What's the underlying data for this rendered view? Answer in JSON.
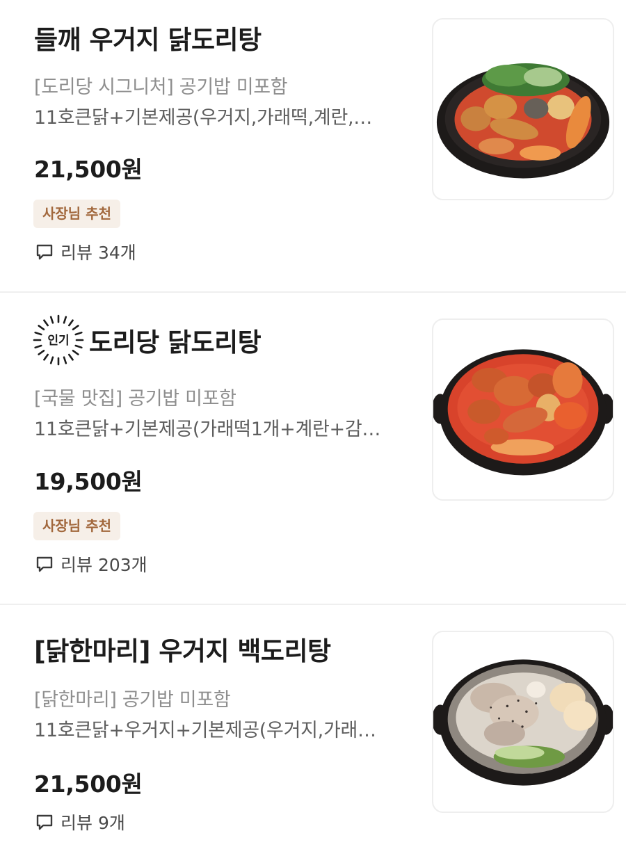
{
  "menu_items": [
    {
      "title": "들깨 우거지 닭도리탕",
      "popular_label": null,
      "description_line1": "[도리당 시그니처] 공기밥 미포함",
      "description_line2": "11호큰닭+기본제공(우거지,가래떡,계란,…",
      "price": "21,500원",
      "recommend_badge": "사장님 추천",
      "review_label": "리뷰 34개",
      "image_icon": "food-photo-deulkkae-dakdoritang"
    },
    {
      "title": "도리당 닭도리탕",
      "popular_label": "인기",
      "description_line1": "[국물 맛집] 공기밥 미포함",
      "description_line2": "11호큰닭+기본제공(가래떡1개+계란+감…",
      "price": "19,500원",
      "recommend_badge": "사장님 추천",
      "review_label": "리뷰 203개",
      "image_icon": "food-photo-doridang-dakdoritang"
    },
    {
      "title": "[닭한마리]  우거지 백도리탕",
      "popular_label": null,
      "description_line1": "[닭한마리]  공기밥 미포함",
      "description_line2": "11호큰닭+우거지+기본제공(우거지,가래…",
      "price": "21,500원",
      "recommend_badge": null,
      "review_label": "리뷰 9개",
      "image_icon": "food-photo-baek-doritang"
    }
  ],
  "colors": {
    "title": "#1c1c1c",
    "description": "#8e8e8e",
    "badge_background": "#f6efe8",
    "badge_text": "#a2683d",
    "divider": "#efefef",
    "broth_red": "#d8432b",
    "broth_white": "#dcd5cb"
  }
}
